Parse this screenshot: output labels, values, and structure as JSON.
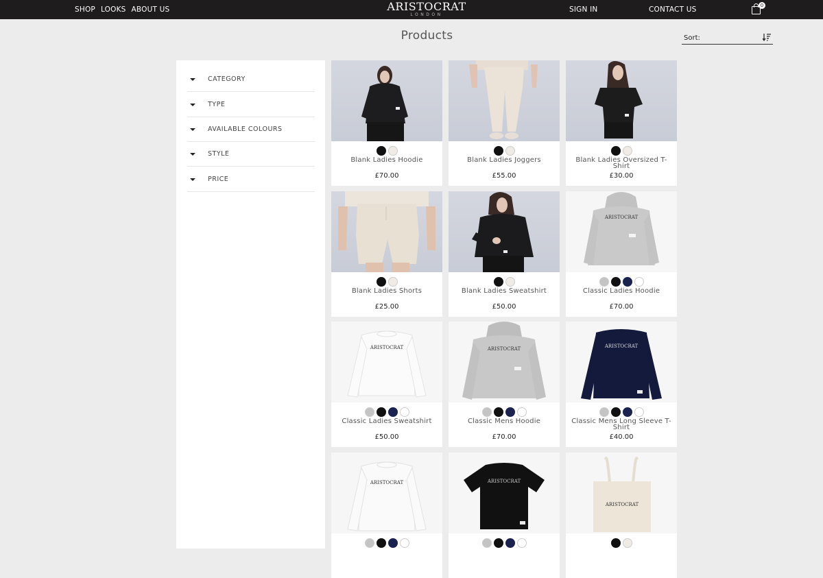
{
  "nav": {
    "shop": "SHOP",
    "looks": "LOOKS",
    "about": "ABOUT US",
    "signin": "SIGN IN",
    "contact": "CONTACT US",
    "cart_count": "0"
  },
  "logo": {
    "main": "ARISTOCRAT",
    "sub": "LONDON"
  },
  "page": {
    "title": "Products",
    "sort_label": "Sort:"
  },
  "filters": [
    "CATEGORY",
    "TYPE",
    "AVAILABLE COLOURS",
    "STYLE",
    "PRICE"
  ],
  "colors": {
    "black": "#111111",
    "cream": "#f1ebe6",
    "grey": "#c4c4c4",
    "navy": "#1a2250",
    "white": "#ffffff"
  },
  "products": [
    {
      "name": "Blank Ladies Hoodie",
      "price": "£70.00",
      "swatches": [
        "black",
        "cream"
      ]
    },
    {
      "name": "Blank Ladies Joggers",
      "price": "£55.00",
      "swatches": [
        "black",
        "cream"
      ]
    },
    {
      "name": "Blank Ladies Oversized T-Shirt",
      "price": "£30.00",
      "swatches": [
        "black",
        "cream"
      ]
    },
    {
      "name": "Blank Ladies Shorts",
      "price": "£25.00",
      "swatches": [
        "black",
        "cream"
      ]
    },
    {
      "name": "Blank Ladies Sweatshirt",
      "price": "£50.00",
      "swatches": [
        "black",
        "cream"
      ]
    },
    {
      "name": "Classic Ladies Hoodie",
      "price": "£70.00",
      "swatches": [
        "grey",
        "black",
        "navy",
        "white"
      ]
    },
    {
      "name": "Classic Ladies Sweatshirt",
      "price": "£50.00",
      "swatches": [
        "grey",
        "black",
        "navy",
        "white"
      ]
    },
    {
      "name": "Classic Mens Hoodie",
      "price": "£70.00",
      "swatches": [
        "grey",
        "black",
        "navy",
        "white"
      ]
    },
    {
      "name": "Classic Mens Long Sleeve T-Shirt",
      "price": "£40.00",
      "swatches": [
        "grey",
        "black",
        "navy",
        "white"
      ]
    },
    {
      "name": "",
      "price": "",
      "swatches": [
        "grey",
        "black",
        "navy",
        "white"
      ]
    },
    {
      "name": "",
      "price": "",
      "swatches": [
        "grey",
        "black",
        "navy",
        "white"
      ]
    },
    {
      "name": "",
      "price": "",
      "swatches": [
        "black",
        "cream"
      ]
    }
  ],
  "print_text": "ARISTOCRAT"
}
